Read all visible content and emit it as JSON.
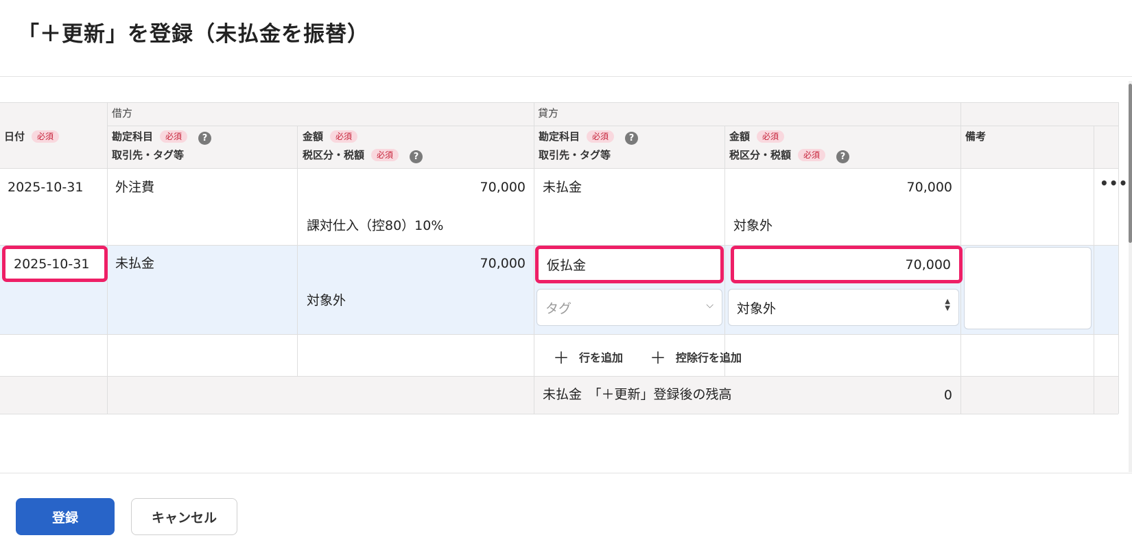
{
  "title": "「＋更新」を登録（未払金を振替）",
  "table": {
    "group_headers": {
      "debit": "借方",
      "credit": "貸方"
    },
    "headers": {
      "date": "日付",
      "required_badge": "必須",
      "help_icon": "?",
      "debit_account": "勘定科目",
      "debit_partner": "取引先・タグ等",
      "debit_amount": "金額",
      "debit_tax": "税区分・税額",
      "credit_account": "勘定科目",
      "credit_partner": "取引先・タグ等",
      "credit_amount": "金額",
      "credit_tax": "税区分・税額",
      "memo": "備考"
    },
    "rows": [
      {
        "date": "2025-10-31",
        "debit_account": "外注費",
        "debit_amount": "70,000",
        "debit_tax": "課対仕入（控80）10%",
        "credit_account": "未払金",
        "credit_amount": "70,000",
        "credit_tax": "対象外",
        "more_icon": "•••"
      },
      {
        "date": "2025-10-31",
        "debit_account": "未払金",
        "debit_amount": "70,000",
        "debit_tax": "対象外",
        "credit_account": "仮払金",
        "credit_tag_placeholder": "タグ",
        "credit_amount": "70,000",
        "credit_tax": "対象外",
        "memo": ""
      }
    ],
    "actions": {
      "add_row": "行を追加",
      "add_deduction_row": "控除行を追加",
      "plus_icon": "＋"
    },
    "balance": {
      "label": "未払金　「＋更新」登録後の残高",
      "value": "0"
    }
  },
  "footer": {
    "register": "登録",
    "cancel": "キャンセル"
  },
  "colors": {
    "primary": "#2864c8",
    "highlight": "#ee1f66",
    "badge_bg": "#f9d8de",
    "badge_text": "#c6243b",
    "edit_row_bg": "#eaf2fc",
    "header_bg": "#f5f3f3"
  }
}
